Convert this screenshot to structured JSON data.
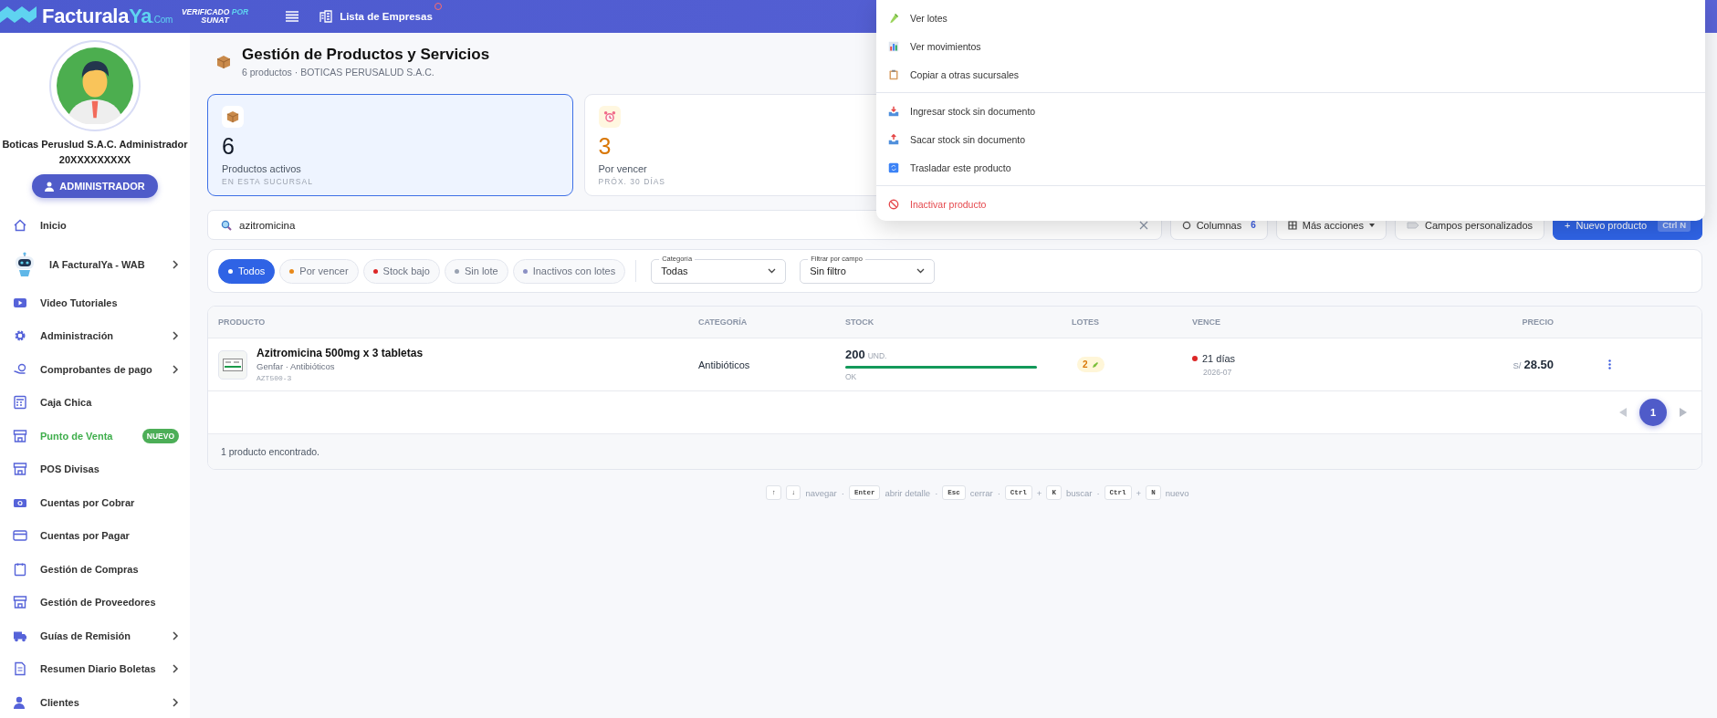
{
  "topbar": {
    "logo": [
      "Facturala",
      "Ya",
      ".Com"
    ],
    "verified": [
      "VERIFICADO",
      "POR",
      "SUNAT"
    ],
    "companies_link": "Lista de Empresas"
  },
  "sidebar": {
    "user_name": "Boticas Peruslud S.A.C. Administrador",
    "ruc": "20XXXXXXXXX",
    "role_button": "ADMINISTRADOR",
    "items": [
      {
        "label": "Inicio",
        "has_submenu": false,
        "highlighted": false
      },
      {
        "label": "IA FacturalYa - WAB",
        "has_submenu": true,
        "highlighted": false
      },
      {
        "label": "Video Tutoriales",
        "has_submenu": false,
        "highlighted": false
      },
      {
        "label": "Administración",
        "has_submenu": true,
        "highlighted": false
      },
      {
        "label": "Comprobantes de pago",
        "has_submenu": true,
        "highlighted": false
      },
      {
        "label": "Caja Chica",
        "has_submenu": false,
        "highlighted": false
      },
      {
        "label": "Punto de Venta",
        "has_submenu": false,
        "highlighted": true,
        "badge": "NUEVO"
      },
      {
        "label": "POS Divisas",
        "has_submenu": false,
        "highlighted": false
      },
      {
        "label": "Cuentas por Cobrar",
        "has_submenu": false,
        "highlighted": false
      },
      {
        "label": "Cuentas por Pagar",
        "has_submenu": false,
        "highlighted": false
      },
      {
        "label": "Gestión de Compras",
        "has_submenu": false,
        "highlighted": false
      },
      {
        "label": "Gestión de Proveedores",
        "has_submenu": false,
        "highlighted": false
      },
      {
        "label": "Guías de Remisión",
        "has_submenu": true,
        "highlighted": false
      },
      {
        "label": "Resumen Diario Boletas",
        "has_submenu": true,
        "highlighted": false
      },
      {
        "label": "Clientes",
        "has_submenu": true,
        "highlighted": false
      }
    ]
  },
  "header": {
    "title": "Gestión de Productos y Servicios",
    "subtitle": "6 productos · BOTICAS PERUSALUD S.A.C."
  },
  "stat_cards": [
    {
      "value": "6",
      "label": "Productos activos",
      "caption": "EN ESTA SUCURSAL",
      "selected": true,
      "color": "#111827"
    },
    {
      "value": "3",
      "label": "Por vencer",
      "caption": "PRÓX. 30 DÍAS",
      "selected": false,
      "color": "#d97706"
    }
  ],
  "toolbar": {
    "search": {
      "value": "azitromicina"
    },
    "columns_button": {
      "label": "Columnas",
      "count": "6"
    },
    "more_actions": "Más acciones",
    "custom_fields": "Campos personalizados",
    "new_product": {
      "plus": "+",
      "label": "Nuevo producto",
      "shortcut": "Ctrl N"
    }
  },
  "filters": {
    "pills": [
      {
        "label": "Todos",
        "selected": true,
        "color": "#ffffff"
      },
      {
        "label": "Por vencer",
        "selected": false,
        "color": "#e8891a"
      },
      {
        "label": "Stock bajo",
        "selected": false,
        "color": "#dc2626"
      },
      {
        "label": "Sin lote",
        "selected": false,
        "color": "#9aa3b2"
      },
      {
        "label": "Inactivos con lotes",
        "selected": false,
        "color": "#8b90c4"
      }
    ],
    "selects": [
      {
        "label": "Categoría",
        "value": "Todas"
      },
      {
        "label": "Filtrar por campo",
        "value": "Sin filtro"
      }
    ]
  },
  "table": {
    "columns": [
      "PRODUCTO",
      "CATEGORÍA",
      "STOCK",
      "LOTES",
      "VENCE",
      "PRECIO"
    ],
    "rows": [
      {
        "name": "Azitromicina 500mg x 3 tabletas",
        "brand": "Genfar · Antibióticos",
        "code": "AZT500-3",
        "category": "Antibióticos",
        "stock": "200",
        "unit": "UND.",
        "stock_status": "OK",
        "level": 1,
        "lots": "2",
        "expires": "21 días",
        "color": "#dc2626",
        "expires_month": "2026-07",
        "currency": "S/",
        "price": "28.50"
      }
    ],
    "pagination": {
      "pages": [
        {
          "label": "1",
          "selected": true
        }
      ],
      "prev_disabled": true
    },
    "footer": "1 producto encontrado."
  },
  "shortcuts": [
    {
      "kind": "key",
      "text": "↑"
    },
    {
      "kind": "key",
      "text": "↓"
    },
    {
      "kind": "label",
      "text": "navegar"
    },
    {
      "kind": "sep",
      "text": "·"
    },
    {
      "kind": "key",
      "text": "Enter"
    },
    {
      "kind": "label",
      "text": "abrir detalle"
    },
    {
      "kind": "sep",
      "text": "·"
    },
    {
      "kind": "key",
      "text": "Esc"
    },
    {
      "kind": "label",
      "text": "cerrar"
    },
    {
      "kind": "sep",
      "text": "·"
    },
    {
      "kind": "key",
      "text": "Ctrl"
    },
    {
      "kind": "plus",
      "text": "+"
    },
    {
      "kind": "key",
      "text": "K"
    },
    {
      "kind": "label",
      "text": "buscar"
    },
    {
      "kind": "sep",
      "text": "·"
    },
    {
      "kind": "key",
      "text": "Ctrl"
    },
    {
      "kind": "plus",
      "text": "+"
    },
    {
      "kind": "key",
      "text": "N"
    },
    {
      "kind": "label",
      "text": "nuevo"
    }
  ],
  "action_menu": {
    "groups": [
      [
        {
          "label": "Ver lotes",
          "danger": false
        },
        {
          "label": "Ver movimientos",
          "danger": false
        },
        {
          "label": "Copiar a otras sucursales",
          "danger": false
        }
      ],
      [
        {
          "label": "Ingresar stock sin documento",
          "danger": false
        },
        {
          "label": "Sacar stock sin documento",
          "danger": false
        },
        {
          "label": "Trasladar este producto",
          "danger": false
        }
      ],
      [
        {
          "label": "Inactivar producto",
          "danger": true
        }
      ]
    ]
  }
}
